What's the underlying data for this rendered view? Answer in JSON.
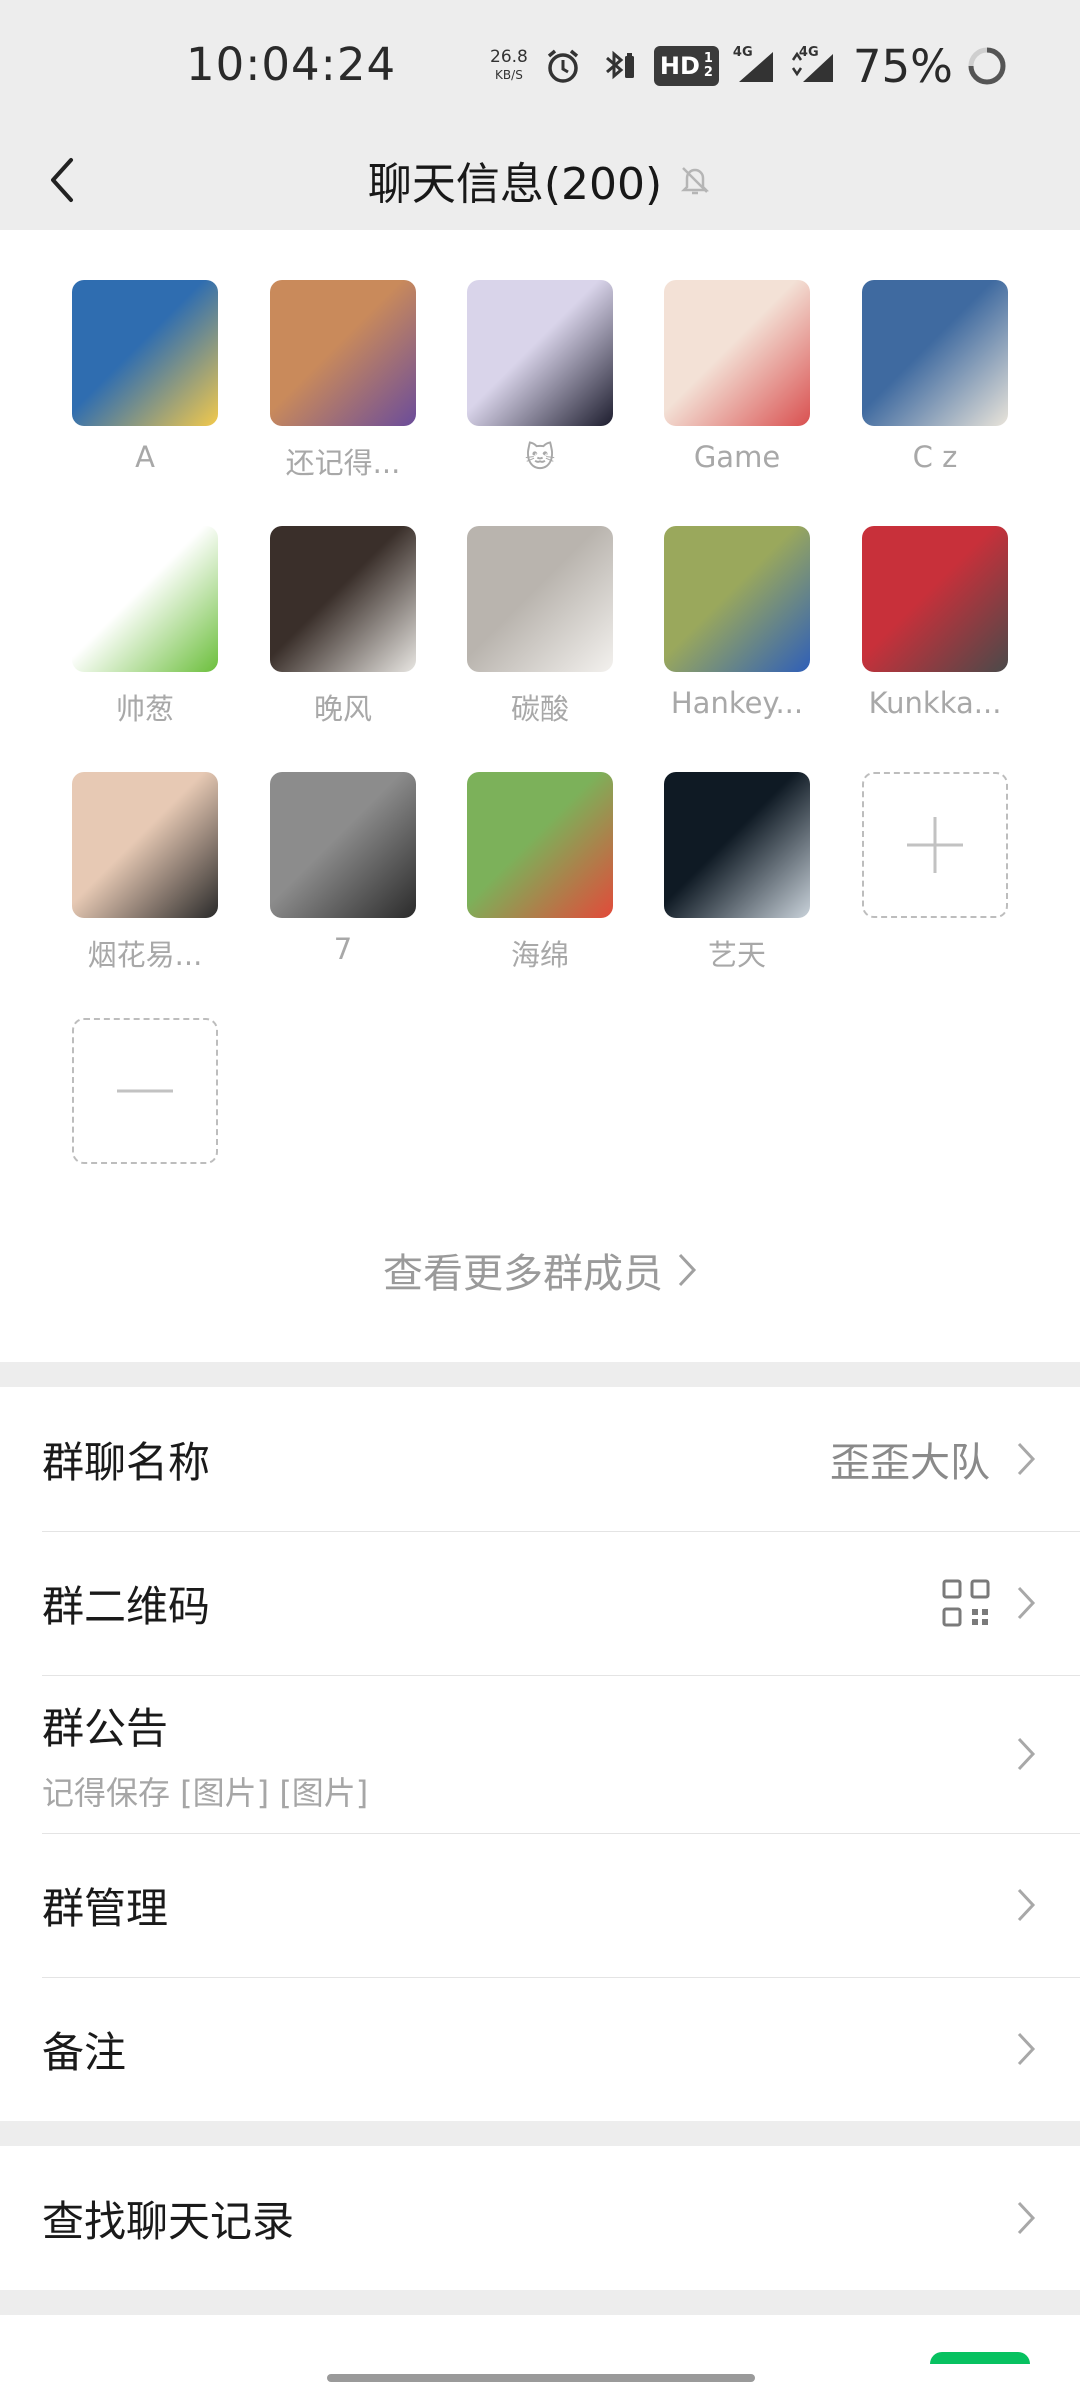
{
  "status_bar": {
    "time": "10:04:24",
    "speed_value": "26.8",
    "speed_unit": "KB/S",
    "hd_label": "HD",
    "hd_sub_top": "1",
    "hd_sub_bottom": "2",
    "network_1": "4G",
    "network_2": "4G",
    "battery": "75%"
  },
  "header": {
    "title": "聊天信息(200)"
  },
  "members": [
    {
      "name": "A",
      "colors": [
        "#2f6db0",
        "#f2c94c"
      ]
    },
    {
      "name": "还记得...",
      "colors": [
        "#c98a5b",
        "#6b4c9a"
      ]
    },
    {
      "name": "🐱",
      "colors": [
        "#d9d4ea",
        "#1d1d2e"
      ]
    },
    {
      "name": "Game",
      "colors": [
        "#f3e1d6",
        "#d95050"
      ]
    },
    {
      "name": "C z",
      "colors": [
        "#3f6aa0",
        "#e9e4da"
      ]
    },
    {
      "name": "帅葱",
      "colors": [
        "#ffffff",
        "#6cbf3c"
      ]
    },
    {
      "name": "晚风",
      "colors": [
        "#3a2f2a",
        "#e8e6e2"
      ]
    },
    {
      "name": "碳酸",
      "colors": [
        "#b9b4ae",
        "#f3f1ee"
      ]
    },
    {
      "name": "Hankey...",
      "colors": [
        "#9aa85c",
        "#2f5fb8"
      ]
    },
    {
      "name": "Kunkka...",
      "colors": [
        "#c8303a",
        "#4a4a4a"
      ]
    },
    {
      "name": "烟花易...",
      "colors": [
        "#e7c9b4",
        "#2a2a2a"
      ]
    },
    {
      "name": "7",
      "colors": [
        "#8c8c8c",
        "#2b2b2b"
      ]
    },
    {
      "name": "海绵",
      "colors": [
        "#7cb15a",
        "#e24a3a"
      ]
    },
    {
      "name": "艺天",
      "colors": [
        "#0f1a24",
        "#c9d2da"
      ]
    }
  ],
  "more_members_label": "查看更多群成员",
  "settings": {
    "group_name_label": "群聊名称",
    "group_name_value": "歪歪大队",
    "qr_label": "群二维码",
    "announcement_label": "群公告",
    "announcement_preview": "记得保存 [图片] [图片]",
    "manage_label": "群管理",
    "remark_label": "备注",
    "search_history_label": "查找聊天记录"
  }
}
